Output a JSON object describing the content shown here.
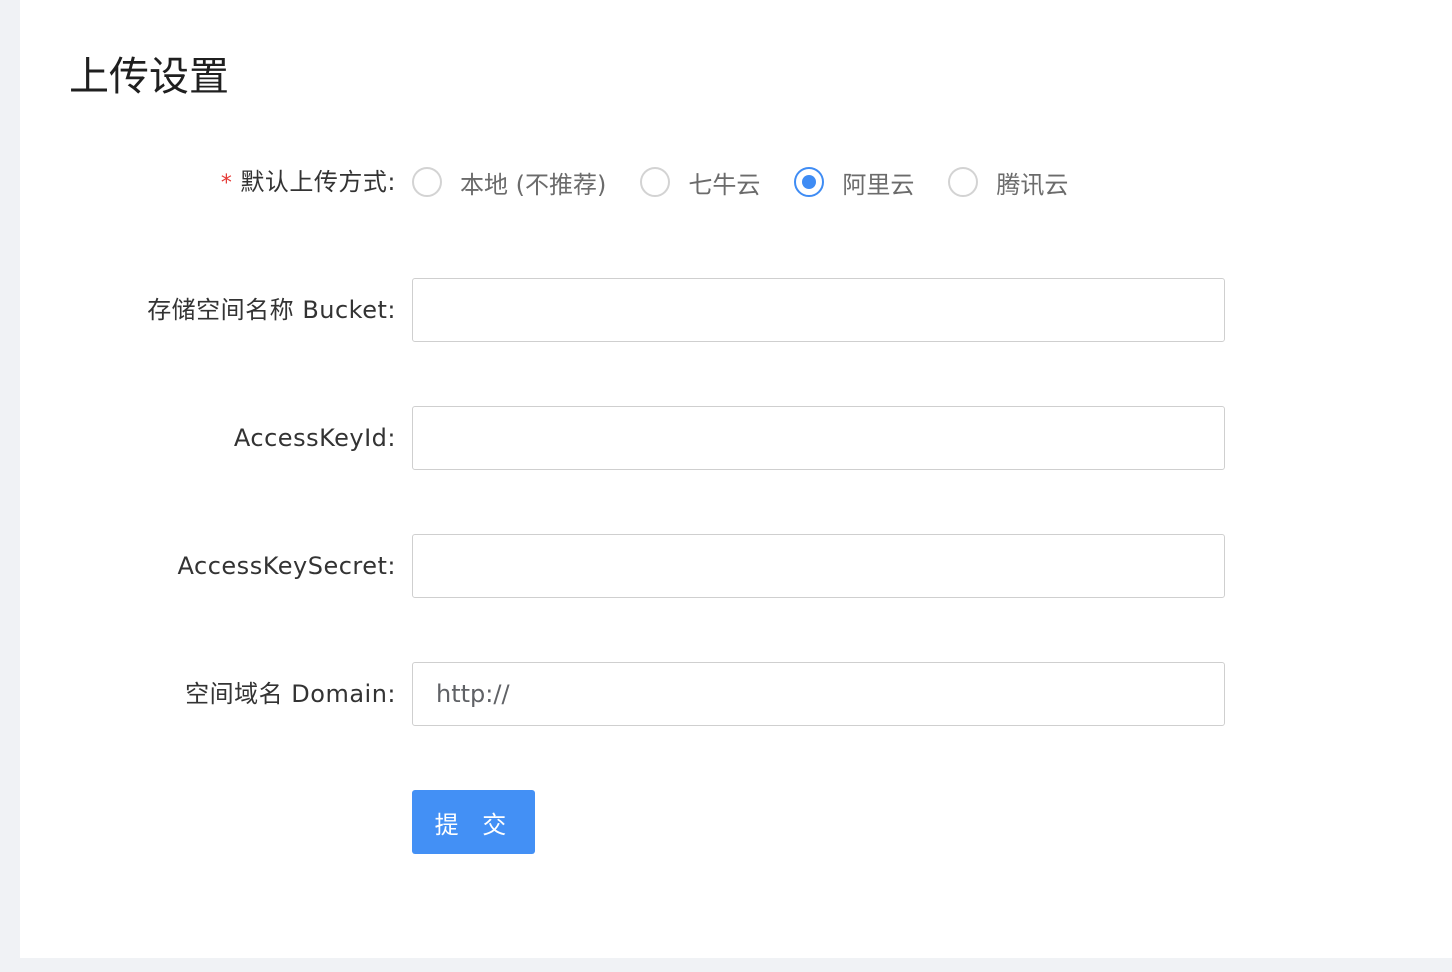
{
  "page": {
    "title": "上传设置"
  },
  "form": {
    "upload_method": {
      "label": "默认上传方式:",
      "required_mark": "*",
      "selected": "阿里云",
      "options": [
        {
          "label": "本地 (不推荐)",
          "checked": false
        },
        {
          "label": "七牛云",
          "checked": false
        },
        {
          "label": "阿里云",
          "checked": true
        },
        {
          "label": "腾讯云",
          "checked": false
        }
      ]
    },
    "bucket": {
      "label": "存储空间名称 Bucket:",
      "value": "",
      "placeholder": ""
    },
    "access_key_id": {
      "label": "AccessKeyId:",
      "value": "",
      "placeholder": ""
    },
    "access_key_secret": {
      "label": "AccessKeySecret:",
      "value": "",
      "placeholder": ""
    },
    "domain": {
      "label": "空间域名 Domain:",
      "value": "http://",
      "placeholder": ""
    },
    "submit_label": "提 交"
  },
  "colors": {
    "accent": "#4390f5",
    "required": "#e53935",
    "page_background": "#f0f2f5",
    "card_background": "#ffffff"
  }
}
